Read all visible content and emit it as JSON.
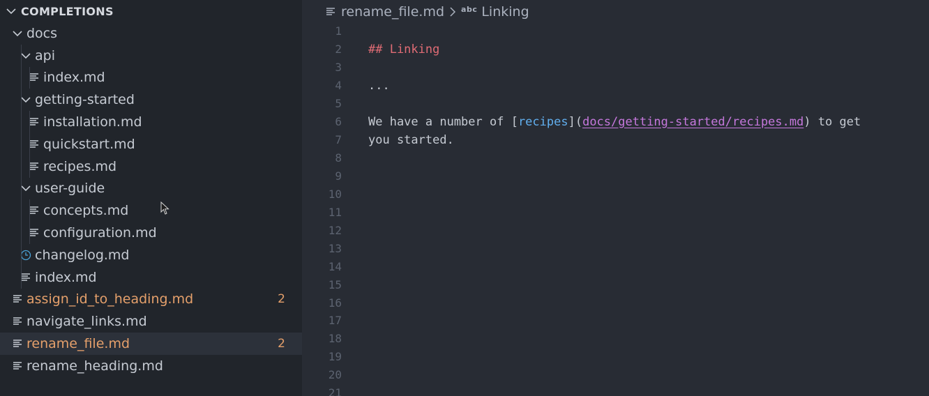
{
  "explorer": {
    "section_title": "COMPLETIONS",
    "items": [
      {
        "label": "docs",
        "kind": "folder",
        "depth": 0
      },
      {
        "label": "api",
        "kind": "folder",
        "depth": 1
      },
      {
        "label": "index.md",
        "kind": "file",
        "depth": 2
      },
      {
        "label": "getting-started",
        "kind": "folder",
        "depth": 1
      },
      {
        "label": "installation.md",
        "kind": "file",
        "depth": 2
      },
      {
        "label": "quickstart.md",
        "kind": "file",
        "depth": 2
      },
      {
        "label": "recipes.md",
        "kind": "file",
        "depth": 2
      },
      {
        "label": "user-guide",
        "kind": "folder",
        "depth": 1
      },
      {
        "label": "concepts.md",
        "kind": "file",
        "depth": 2
      },
      {
        "label": "configuration.md",
        "kind": "file",
        "depth": 2
      },
      {
        "label": "changelog.md",
        "kind": "history-file",
        "depth": 1
      },
      {
        "label": "index.md",
        "kind": "file",
        "depth": 1
      },
      {
        "label": "assign_id_to_heading.md",
        "kind": "file",
        "depth": 0,
        "badge": "2",
        "modified": true
      },
      {
        "label": "navigate_links.md",
        "kind": "file",
        "depth": 0
      },
      {
        "label": "rename_file.md",
        "kind": "file",
        "depth": 0,
        "badge": "2",
        "modified": true,
        "selected": true
      },
      {
        "label": "rename_heading.md",
        "kind": "file",
        "depth": 0
      }
    ]
  },
  "breadcrumb": {
    "file": "rename_file.md",
    "symbol_kind": "abc",
    "symbol": "Linking"
  },
  "editor": {
    "line_numbers": [
      "1",
      "2",
      "3",
      "4",
      "5",
      "6",
      "7",
      "8",
      "9",
      "10",
      "11",
      "12",
      "13",
      "14",
      "15",
      "16",
      "17",
      "18",
      "19",
      "20",
      "21"
    ],
    "heading": "## Linking",
    "ellipsis": "...",
    "para_start": "We have a number of [",
    "link_text": "recipes",
    "link_mid": "](",
    "link_url": "docs/getting-started/recipes.md",
    "para_end": ") to get",
    "para_wrap": "you started."
  },
  "colors": {
    "sidebar_bg": "#21252b",
    "editor_bg": "#282c34",
    "modified": "#e5a06b",
    "heading": "#e06c75",
    "link_text": "#61afef",
    "link_url": "#c678dd",
    "history_icon": "#4aa3d9"
  }
}
